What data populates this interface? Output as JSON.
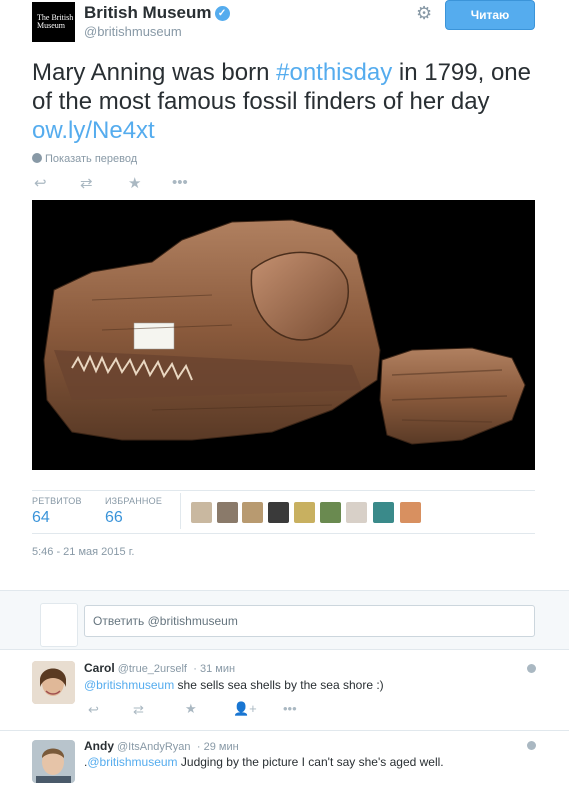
{
  "header": {
    "logo_text": "The British Museum",
    "name": "British Museum",
    "handle": "@britishmuseum",
    "follow_label": "Читаю"
  },
  "tweet": {
    "text_1": "Mary Anning was born ",
    "hashtag": "#onthisday",
    "text_2": " in 1799, one of the most famous fossil finders of her day ",
    "link": "ow.ly/Ne4xt",
    "translate_label": "Показать перевод",
    "retweets_label": "РЕТВИТОВ",
    "retweets_count": "64",
    "favorites_label": "ИЗБРАННОЕ",
    "favorites_count": "66",
    "timestamp": "5:46 - 21 мая 2015 г."
  },
  "reply_box": {
    "placeholder": "Ответить @britishmuseum"
  },
  "replies": [
    {
      "name": "Carol",
      "handle": "@true_2urself",
      "time": "· 31 мин",
      "mention": "@britishmuseum",
      "text": " she sells sea shells by the sea shore :)"
    },
    {
      "name": "Andy",
      "handle": "@ItsAndyRyan",
      "time": "· 29 мин",
      "prefix": ".",
      "mention": "@britishmuseum",
      "text": " Judging by the picture I can't say she's aged well."
    }
  ],
  "icons": [
    "verified-icon",
    "gear-icon",
    "globe-icon",
    "reply-icon",
    "retweet-icon",
    "favorite-icon",
    "more-icon",
    "follow-user-icon"
  ],
  "colors": {
    "accent": "#55acee",
    "muted": "#8899a6",
    "border": "#e1e8ed"
  }
}
